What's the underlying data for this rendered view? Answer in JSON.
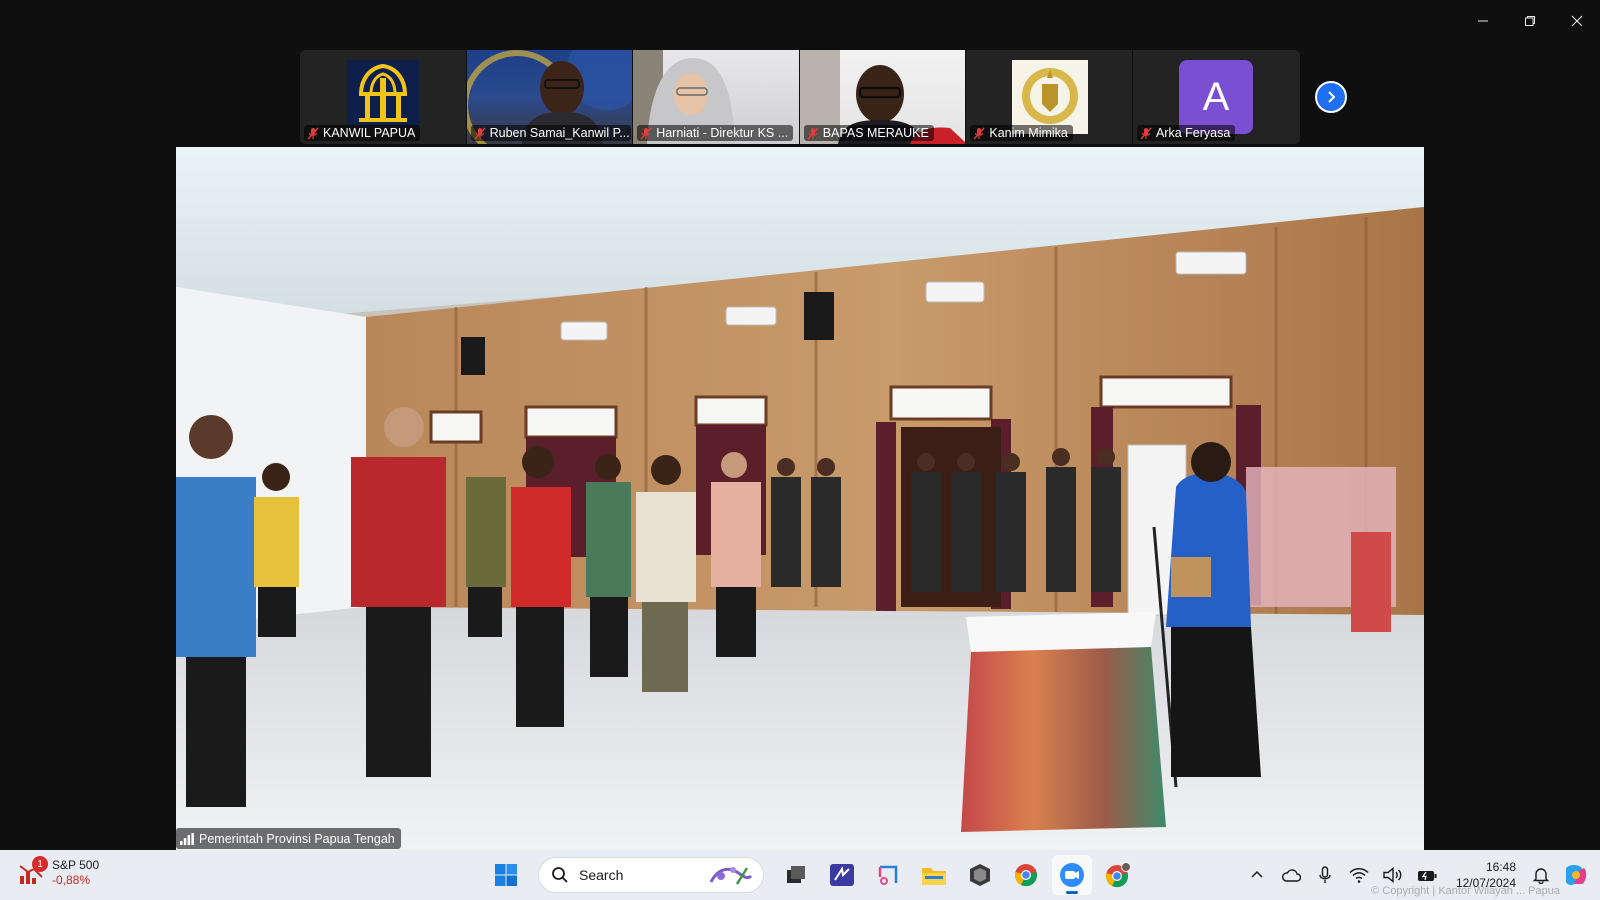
{
  "window": {
    "controls": [
      {
        "name": "minimize-icon"
      },
      {
        "name": "restore-icon"
      },
      {
        "name": "close-icon"
      }
    ]
  },
  "participants": [
    {
      "name": "KANWIL PAPUA",
      "muted": true,
      "kind": "logo"
    },
    {
      "name": "Ruben Samai_Kanwil P...",
      "muted": true,
      "kind": "video"
    },
    {
      "name": "Harniati - Direktur KS ...",
      "muted": true,
      "kind": "video"
    },
    {
      "name": "BAPAS MERAUKE",
      "muted": true,
      "kind": "video"
    },
    {
      "name": "Kanim Mimika",
      "muted": true,
      "kind": "logo"
    },
    {
      "name": "Arka Feryasa",
      "muted": true,
      "kind": "avatar",
      "initial": "A",
      "avatar_color": "#7a4fd1"
    }
  ],
  "active_speaker": {
    "name": "Pemerintah Provinsi Papua Tengah"
  },
  "taskbar": {
    "stock": {
      "badge": "1",
      "name": "S&P 500",
      "change": "-0,88%"
    },
    "search_label": "Search",
    "apps": [
      "windows-start-icon",
      "task-view-icon",
      "app-icon",
      "snipping-tool-icon",
      "file-explorer-icon",
      "app-icon-2",
      "chrome-icon",
      "zoom-icon",
      "chrome-profile-icon"
    ],
    "clock": {
      "time": "16:48",
      "date": "12/07/2024"
    }
  },
  "watermark": "© Copyright | Kantor Wilayah ... Papua"
}
